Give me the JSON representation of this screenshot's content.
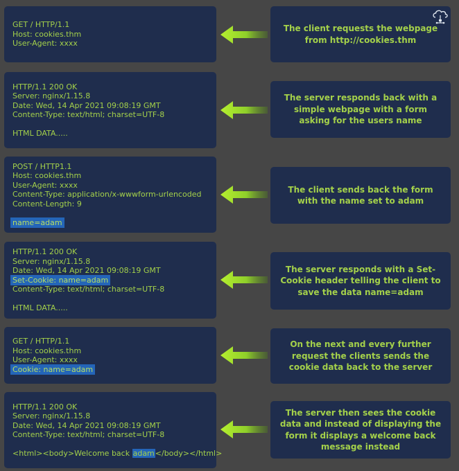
{
  "steps": [
    {
      "left_lines": [
        "GET / HTTP/1.1",
        "Host: cookies.thm",
        "User-Agent: xxxx"
      ],
      "right_text": "The client requests the webpage from http://cookies.thm"
    },
    {
      "left_lines": [
        "HTTP/1.1 200 OK",
        "Server: nginx/1.15.8",
        "Date: Wed, 14 Apr 2021 09:08:19 GMT",
        "Content-Type: text/html; charset=UTF-8",
        "",
        "HTML DATA....."
      ],
      "right_text": "The server responds back with a simple webpage with a form asking for the users name"
    },
    {
      "left_lines": [
        "POST / HTTP1.1",
        "Host: cookies.thm",
        "User-Agent: xxxx",
        "Content-Type: application/x-wwwform-urlencoded",
        "Content-Length: 9",
        "",
        "name=adam"
      ],
      "right_text": "The client sends back the form with the name set to adam"
    },
    {
      "left_lines": [
        "HTTP/1.1 200 OK",
        "Server: nginx/1.15.8",
        "Date: Wed, 14 Apr 2021 09:08:19 GMT",
        "Set-Cookie: name=adam",
        "Content-Type: text/html; charset=UTF-8",
        "",
        "HTML DATA....."
      ],
      "right_text": "The server responds with a Set-Cookie header telling the client to save the data name=adam"
    },
    {
      "left_lines": [
        "GET / HTTP/1.1",
        "Host: cookies.thm",
        "User-Agent: xxxx",
        "Cookie: name=adam"
      ],
      "right_text": "On the next and every further request the clients sends the cookie data back to the server"
    },
    {
      "left_lines": [
        "HTTP/1.1 200 OK",
        "Server: nginx/1.15.8",
        "Date: Wed, 14 Apr 2021 09:08:19 GMT",
        "Content-Type: text/html; charset=UTF-8",
        "",
        "<html><body>Welcome back ",
        "adam",
        "</body></html>"
      ],
      "right_text": "The server then sees the cookie data and instead of displaying the form it displays a welcome back message instead"
    }
  ],
  "icon": "cloud-network-icon",
  "colors": {
    "background": "#464646",
    "box": "#1f2d4d",
    "text": "#a4d14a",
    "highlight": "#2465b8",
    "arrow": "#9fd630"
  }
}
